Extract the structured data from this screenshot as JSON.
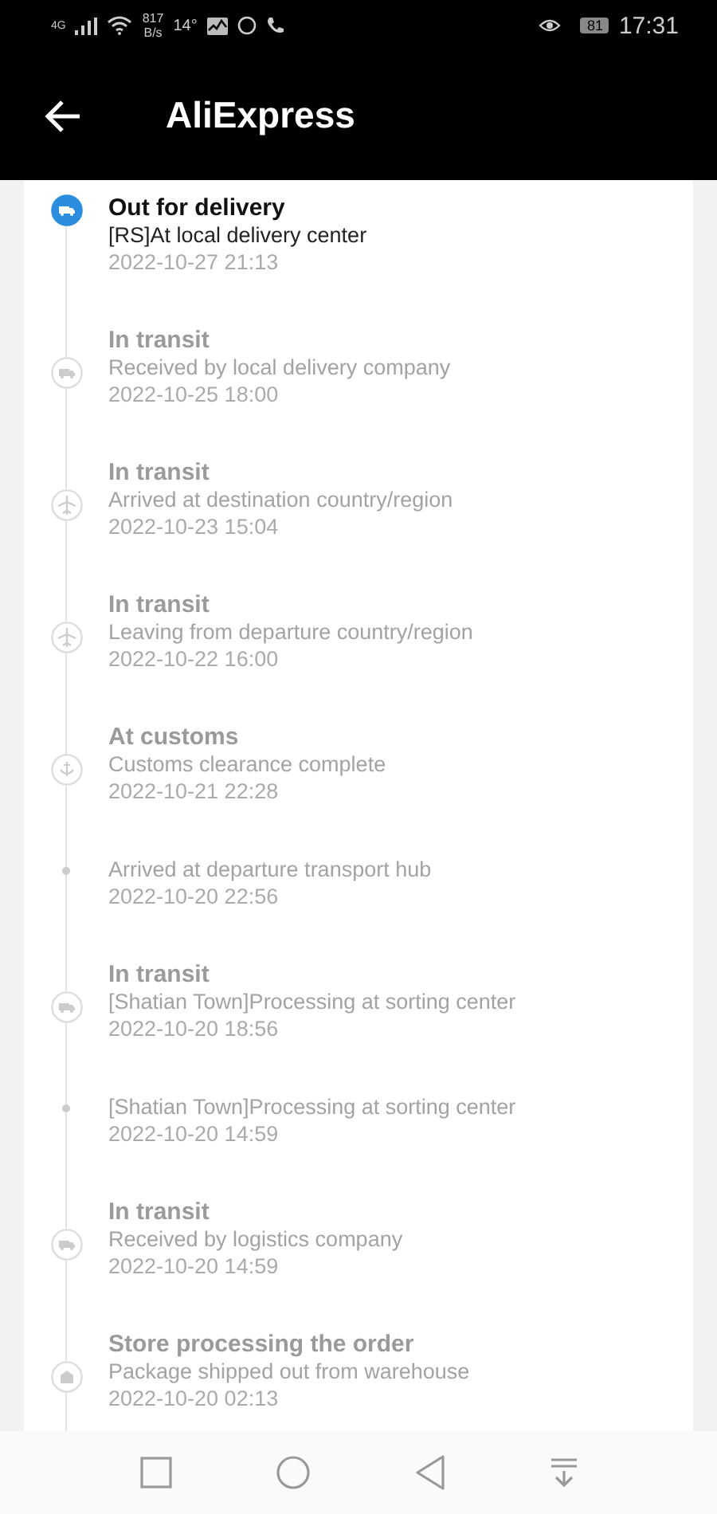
{
  "status_bar": {
    "network": "4G",
    "speed": "817",
    "speed_unit": "B/s",
    "temperature": "14°",
    "battery": "81",
    "time": "17:31"
  },
  "header": {
    "title": "AliExpress"
  },
  "events": [
    {
      "kind": "truck",
      "current": true,
      "title": "Out for delivery",
      "detail": "[RS]At local delivery center",
      "time": "2022-10-27 21:13"
    },
    {
      "kind": "truck",
      "current": false,
      "title": "In transit",
      "detail": "Received by local delivery company",
      "time": "2022-10-25 18:00"
    },
    {
      "kind": "plane",
      "current": false,
      "title": "In transit",
      "detail": "Arrived at destination country/region",
      "time": "2022-10-23 15:04"
    },
    {
      "kind": "plane",
      "current": false,
      "title": "In transit",
      "detail": "Leaving from departure country/region",
      "time": "2022-10-22 16:00"
    },
    {
      "kind": "customs",
      "current": false,
      "title": "At customs",
      "detail": "Customs clearance complete",
      "time": "2022-10-21 22:28"
    },
    {
      "kind": "dot",
      "current": false,
      "detail": "Arrived at departure transport hub",
      "time": "2022-10-20 22:56"
    },
    {
      "kind": "truck",
      "current": false,
      "title": "In transit",
      "detail": "[Shatian Town]Processing at sorting center",
      "time": "2022-10-20 18:56"
    },
    {
      "kind": "dot",
      "current": false,
      "detail": "[Shatian Town]Processing at sorting center",
      "time": "2022-10-20 14:59"
    },
    {
      "kind": "truck",
      "current": false,
      "title": "In transit",
      "detail": "Received by logistics company",
      "time": "2022-10-20 14:59"
    },
    {
      "kind": "store",
      "current": false,
      "title": "Store processing the order",
      "detail": "Package shipped out from warehouse",
      "time": "2022-10-20 02:13"
    }
  ]
}
